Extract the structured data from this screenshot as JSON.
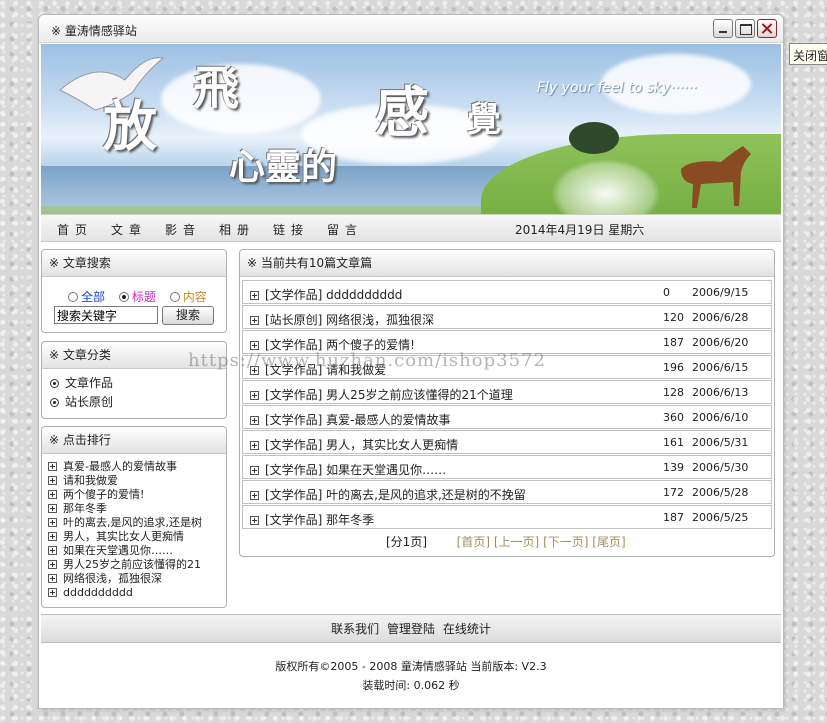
{
  "window": {
    "title": "※ 童涛情感驿站"
  },
  "side_tooltip": "关闭窗",
  "banner": {
    "chars": [
      "放",
      "飛",
      "感",
      "覺",
      "心靈的"
    ],
    "english": "Fly your feel to sky······"
  },
  "nav": {
    "items": [
      "首页",
      "文章",
      "影音",
      "相册",
      "链接",
      "留言"
    ],
    "date": "2014年4月19日 星期六"
  },
  "search": {
    "header": "※ 文章搜索",
    "options": [
      "全部",
      "标题",
      "内容"
    ],
    "selected": "标题",
    "input_value": "搜索关键字",
    "button": "搜索",
    "colors": {
      "all": "#1a3fd0",
      "title": "#c42ec4",
      "content": "#c68a2a"
    }
  },
  "categories": {
    "header": "※ 文章分类",
    "items": [
      "文章作品",
      "站长原创"
    ]
  },
  "ranking": {
    "header": "※ 点击排行",
    "items": [
      "真爱-最感人的爱情故事",
      "请和我做爱",
      "两个傻子的爱情!",
      "那年冬季",
      "叶的离去,是风的追求,还是树",
      "男人，其实比女人更痴情",
      "如果在天堂遇见你……",
      "男人25岁之前应该懂得的21",
      "网络很浅，孤独很深",
      "dddddddddd"
    ]
  },
  "articles": {
    "header": "※ 当前共有10篇文章篇",
    "rows": [
      {
        "title": "[文学作品] dddddddddd",
        "count": "0",
        "date": "2006/9/15"
      },
      {
        "title": "[站长原创] 网络很浅，孤独很深",
        "count": "120",
        "date": "2006/6/28"
      },
      {
        "title": "[文学作品] 两个傻子的爱情!",
        "count": "187",
        "date": "2006/6/20"
      },
      {
        "title": "[文学作品] 请和我做爱",
        "count": "196",
        "date": "2006/6/15"
      },
      {
        "title": "[文学作品] 男人25岁之前应该懂得的21个道理",
        "count": "128",
        "date": "2006/6/13"
      },
      {
        "title": "[文学作品] 真爱-最感人的爱情故事",
        "count": "360",
        "date": "2006/6/10"
      },
      {
        "title": "[文学作品] 男人，其实比女人更痴情",
        "count": "161",
        "date": "2006/5/31"
      },
      {
        "title": "[文学作品] 如果在天堂遇见你……",
        "count": "139",
        "date": "2006/5/30"
      },
      {
        "title": "[文学作品] 叶的离去,是风的追求,还是树的不挽留",
        "count": "172",
        "date": "2006/5/28"
      },
      {
        "title": "[文学作品] 那年冬季",
        "count": "187",
        "date": "2006/5/25"
      }
    ],
    "pager": {
      "pages": "[分1页]",
      "first": "[首页]",
      "prev": "[上一页]",
      "next": "[下一页]",
      "last": "[尾页]"
    }
  },
  "footer": {
    "links": [
      "联系我们",
      "管理登陆",
      "在线统计"
    ],
    "copyright": "版权所有©2005 - 2008 童涛情感驿站 当前版本: V2.3",
    "load_time": "装载时间: 0.062 秒"
  },
  "watermark": "https://www.huzhan.com/ishop3572"
}
